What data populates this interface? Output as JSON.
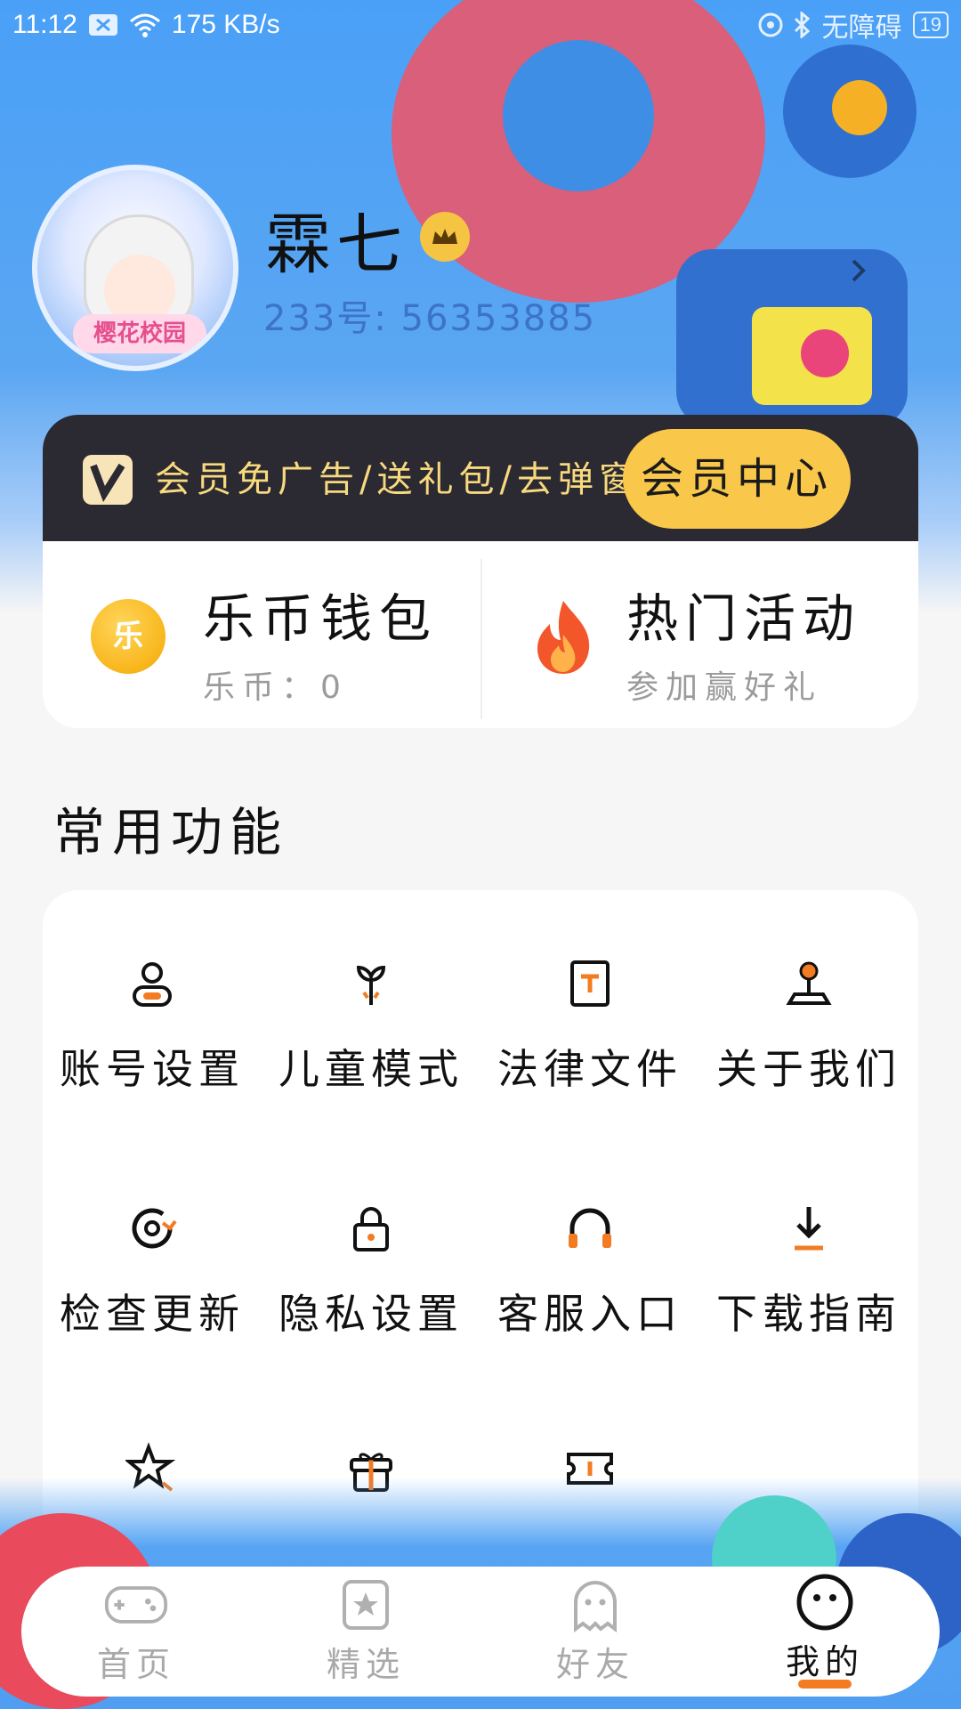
{
  "status_bar": {
    "time": "11:12",
    "speed": "175 KB/s",
    "accessibility": "无障碍",
    "battery": "19"
  },
  "profile": {
    "username": "霖七",
    "id_text": "233号: 56353885",
    "avatar_badge": "樱花校园"
  },
  "vip": {
    "text": "会员免广告/送礼包/去弹窗",
    "button": "会员中心"
  },
  "wallet": {
    "title": "乐币钱包",
    "balance": "乐币：0",
    "coin_glyph": "乐"
  },
  "activities": {
    "title": "热门活动",
    "subtitle": "参加赢好礼"
  },
  "functions": {
    "title": "常用功能",
    "items": [
      {
        "label": "账号设置",
        "icon": "account-icon"
      },
      {
        "label": "儿童模式",
        "icon": "child-mode-icon"
      },
      {
        "label": "法律文件",
        "icon": "legal-icon"
      },
      {
        "label": "关于我们",
        "icon": "about-icon"
      },
      {
        "label": "检查更新",
        "icon": "update-icon"
      },
      {
        "label": "隐私设置",
        "icon": "lock-icon"
      },
      {
        "label": "客服入口",
        "icon": "headset-icon"
      },
      {
        "label": "下载指南",
        "icon": "download-icon"
      },
      {
        "label": "",
        "icon": "star-icon"
      },
      {
        "label": "",
        "icon": "gift-icon"
      },
      {
        "label": "",
        "icon": "ticket-icon"
      }
    ]
  },
  "tabs": [
    {
      "label": "首页",
      "icon": "gamepad-icon",
      "active": false
    },
    {
      "label": "精选",
      "icon": "featured-icon",
      "active": false
    },
    {
      "label": "好友",
      "icon": "ghost-icon",
      "active": false
    },
    {
      "label": "我的",
      "icon": "smiley-icon",
      "active": true
    }
  ],
  "colors": {
    "accent": "#f9c84a",
    "orange": "#f37b22",
    "dark_banner": "#2b2931",
    "hero_blue": "#4aa0f7"
  }
}
